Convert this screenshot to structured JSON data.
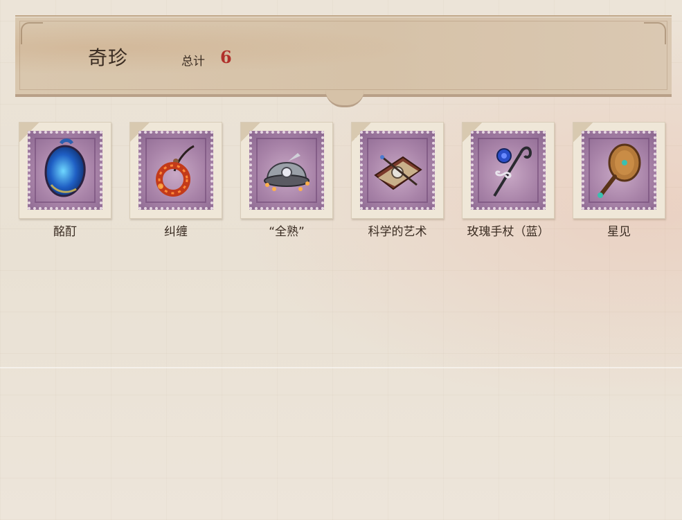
{
  "header": {
    "title": "奇珍",
    "total_label": "总计",
    "total_value": "6"
  },
  "items": [
    {
      "label": "酩酊",
      "icon": "blue-heart-icon"
    },
    {
      "label": "纠缠",
      "icon": "red-ring-pendant-icon"
    },
    {
      "label": "“全熟”",
      "icon": "chef-hat-icon"
    },
    {
      "label": "科学的艺术",
      "icon": "book-gadget-icon"
    },
    {
      "label": "玫瑰手杖（蓝）",
      "icon": "blue-rose-cane-icon"
    },
    {
      "label": "星见",
      "icon": "hand-mirror-icon"
    }
  ],
  "colors": {
    "accent_red": "#b0302a",
    "stamp_purple": "#a883a8",
    "text_dark": "#3a2c22"
  }
}
